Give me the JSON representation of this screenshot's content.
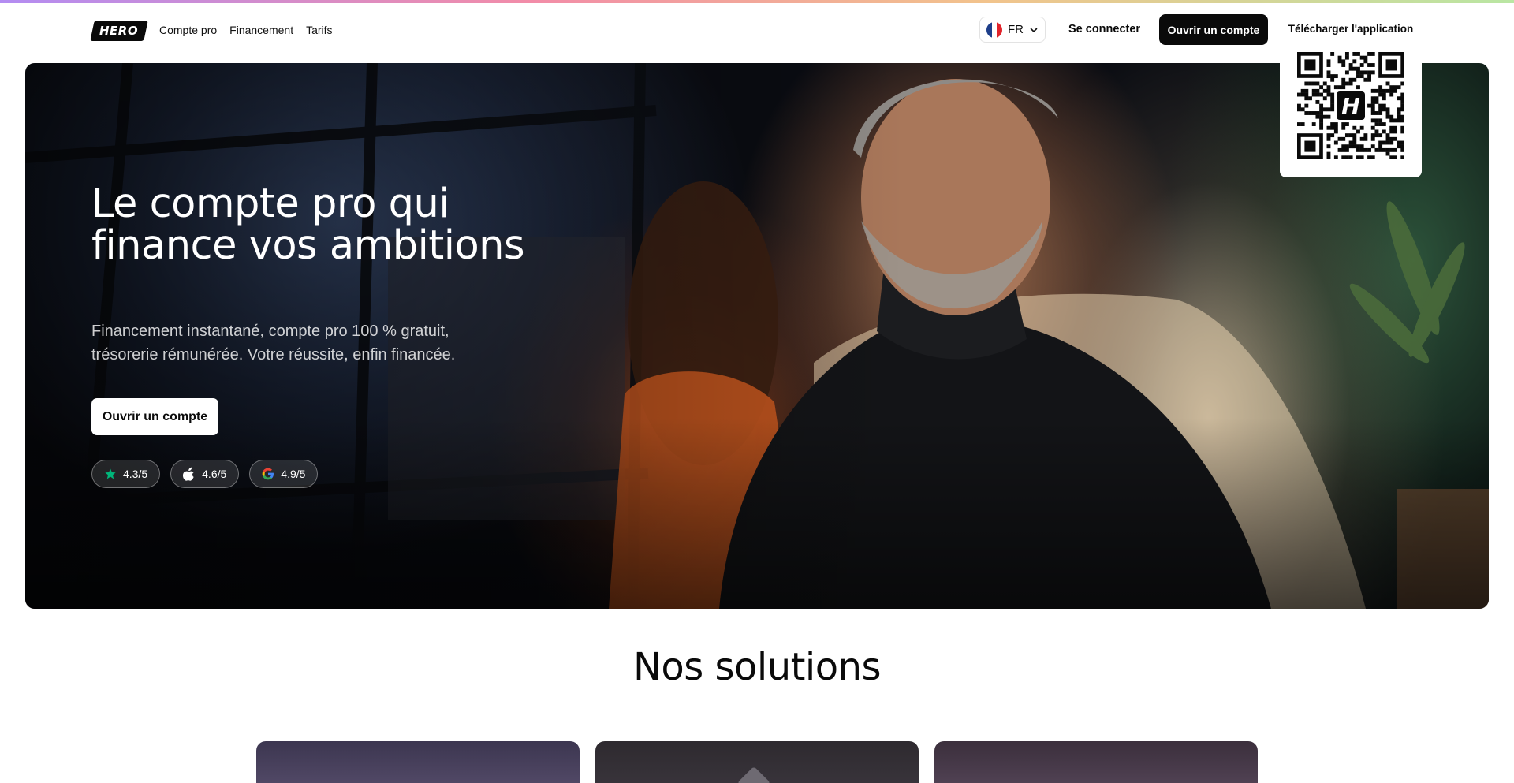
{
  "nav": {
    "logo_text": "HERO",
    "links": [
      "Compte pro",
      "Financement",
      "Tarifs"
    ],
    "language": "FR",
    "login_label": "Se connecter",
    "open_account_label": "Ouvrir un compte",
    "download_app_label": "Télécharger l'application",
    "qr_logo_letter": "H"
  },
  "hero": {
    "title": "Le compte pro qui finance vos ambitions",
    "subtitle": "Financement instantané, compte pro 100 % gratuit, trésorerie rémunérée. Votre réussite, enfin financée.",
    "cta_label": "Ouvrir un compte",
    "ratings": [
      {
        "icon": "star-icon",
        "value": "4.3/5"
      },
      {
        "icon": "apple-icon",
        "value": "4.6/5"
      },
      {
        "icon": "google-icon",
        "value": "4.9/5"
      }
    ]
  },
  "solutions": {
    "title": "Nos solutions"
  },
  "colors": {
    "primary": "#0a0a0a",
    "accent_green": "#00b67a",
    "flag_blue": "#1d3e8a",
    "flag_red": "#e1242b"
  }
}
